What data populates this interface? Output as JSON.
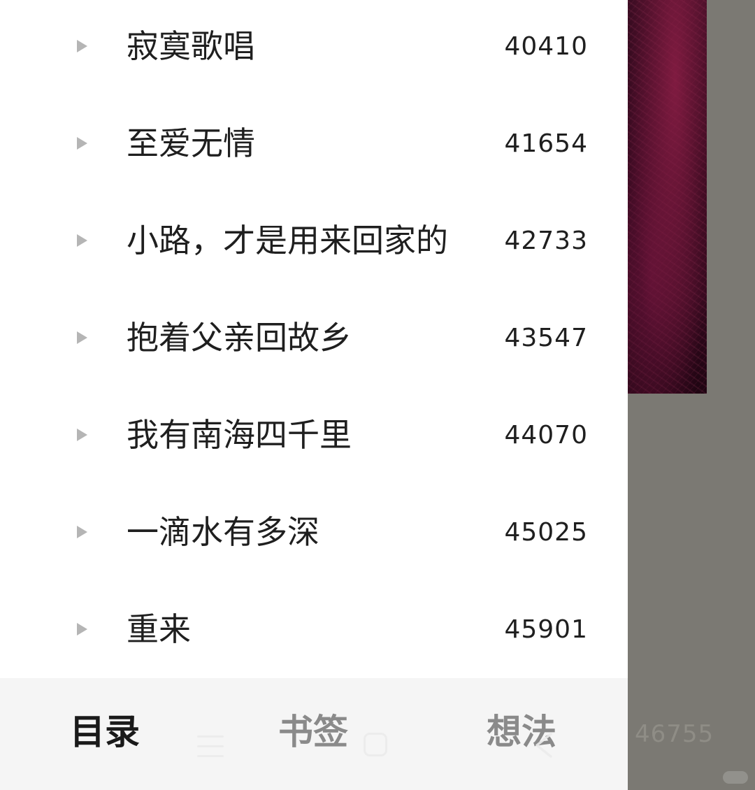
{
  "chapters": [
    {
      "title": "寂寞歌唱",
      "page": "40410"
    },
    {
      "title": "至爱无情",
      "page": "41654"
    },
    {
      "title": "小路，才是用来回家的",
      "page": "42733"
    },
    {
      "title": "抱着父亲回故乡",
      "page": "43547"
    },
    {
      "title": "我有南海四千里",
      "page": "44070"
    },
    {
      "title": "一滴水有多深",
      "page": "45025"
    },
    {
      "title": "重来",
      "page": "45901"
    }
  ],
  "tabs": {
    "toc": "目录",
    "bookmark": "书签",
    "notes": "想法"
  },
  "background": {
    "page_number": "46755"
  },
  "colors": {
    "drawer_bg": "#ffffff",
    "tab_bar_bg": "#f5f5f5",
    "text_primary": "#1f1f1f",
    "text_inactive": "#8a8a8a",
    "overlay_gray": "#7b7973"
  },
  "icons": {
    "row_expand": "triangle-right-icon",
    "nav_menu": "menu-lines-icon",
    "nav_home": "rounded-square-icon",
    "nav_back": "chevron-left-icon"
  }
}
